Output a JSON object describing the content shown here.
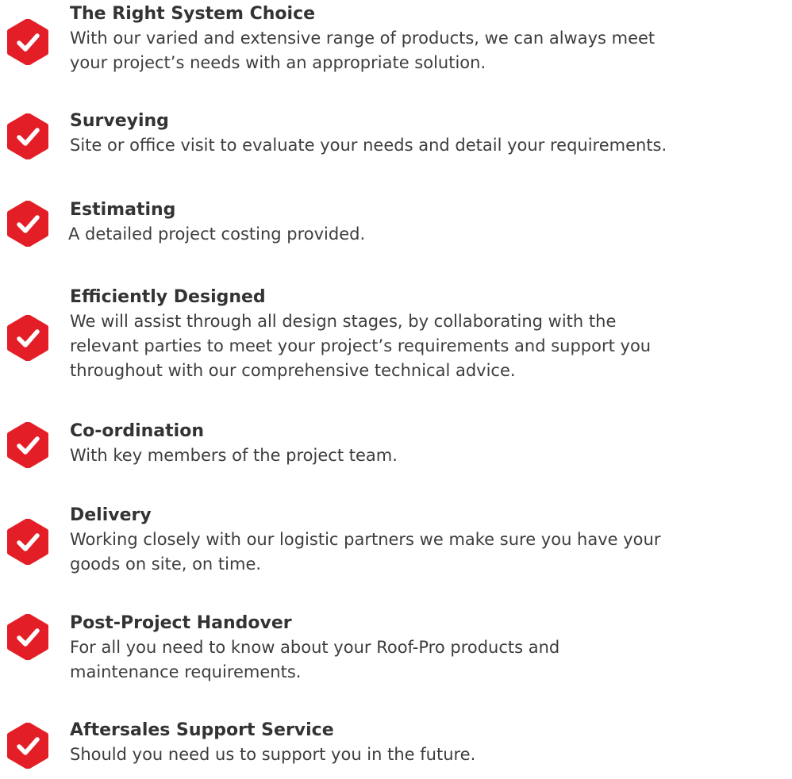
{
  "brand_color": "#e41e26",
  "icon": "check-badge-icon",
  "items": [
    {
      "title": "The Right System Choice",
      "description": "With our varied and extensive range of products, we can always meet\nyour project’s needs with an appropriate solution."
    },
    {
      "title": "Surveying",
      "description": "Site or office visit to evaluate your needs and detail your requirements."
    },
    {
      "title": "Estimating",
      "description": "A detailed project costing provided."
    },
    {
      "title": "Efficiently Designed",
      "description": "We will assist through all design stages, by collaborating with the\nrelevant parties to meet your project’s requirements and support you\nthroughout with our comprehensive technical advice."
    },
    {
      "title": "Co-ordination",
      "description": "With key members of the project team."
    },
    {
      "title": "Delivery",
      "description": "Working closely with our logistic partners we make sure you have your\ngoods on site, on time."
    },
    {
      "title": "Post-Project Handover",
      "description": "For all you need to know about your Roof-Pro products and\nmaintenance requirements."
    },
    {
      "title": "Aftersales Support Service",
      "description": "Should you need us to support you in the future."
    }
  ]
}
